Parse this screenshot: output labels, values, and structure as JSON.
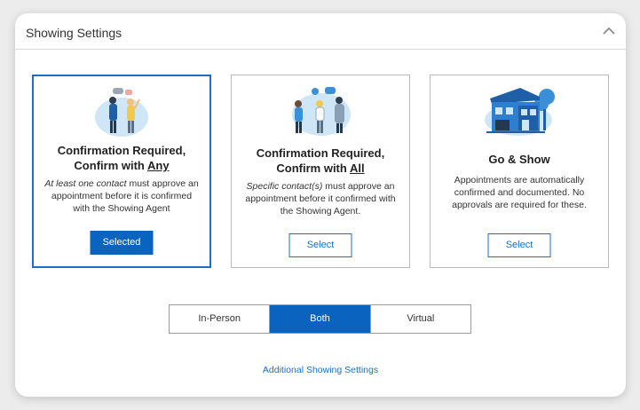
{
  "header": {
    "title": "Showing Settings",
    "collapse_icon": "chevron-up-icon"
  },
  "cards": [
    {
      "title_line1": "Confirmation Required,",
      "title_prefix": "Confirm with ",
      "title_emph": "Any",
      "desc_emph": "At least one contact",
      "desc_rest": " must approve an appointment before it is confirmed with the Showing Agent",
      "button_label": "Selected",
      "selected": true
    },
    {
      "title_line1": "Confirmation Required,",
      "title_prefix": "Confirm with ",
      "title_emph": "All",
      "desc_emph": "Specific contact(s)",
      "desc_rest": " must approve an appointment before it confirmed with the Showing Agent.",
      "button_label": "Select",
      "selected": false
    },
    {
      "title_line1": "Go & Show",
      "desc_rest": "Appointments are automatically confirmed and documented.  No approvals are required for these.",
      "button_label": "Select",
      "selected": false
    }
  ],
  "showing_type": {
    "options": [
      "In-Person",
      "Both",
      "Virtual"
    ],
    "selected": "Both"
  },
  "additional_link": "Additional Showing Settings",
  "colors": {
    "accent": "#0a63be",
    "illustration_light": "#cfe6f7",
    "illustration_blue": "#3b8fd6"
  }
}
